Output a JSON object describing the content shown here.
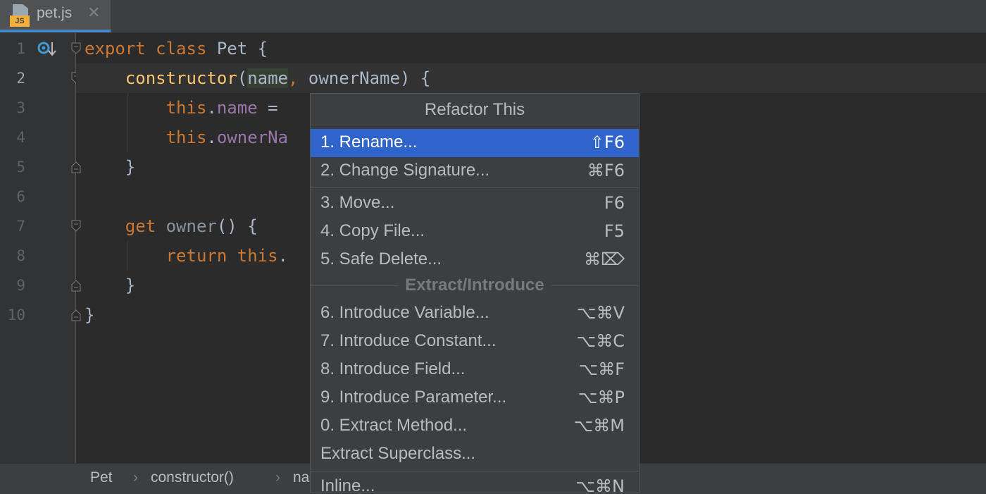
{
  "tab": {
    "file_name": "pet.js",
    "file_type_badge": "JS",
    "close_glyph": "✕"
  },
  "gutter": {
    "line_numbers": [
      "1",
      "2",
      "3",
      "4",
      "5",
      "6",
      "7",
      "8",
      "9",
      "10"
    ],
    "current_line": "2"
  },
  "code": {
    "l1": {
      "kw1": "export",
      "kw2": "class",
      "name": "Pet {"
    },
    "l2": {
      "fn": "constructor",
      "open": "(",
      "param": "name",
      "comma": ",",
      "rest": " ownerName) {"
    },
    "l3": {
      "this": "this",
      "dot": ".",
      "prop": "name",
      "rest": " ="
    },
    "l4": {
      "this": "this",
      "dot": ".",
      "prop": "ownerNa"
    },
    "l5": {
      "text": "}"
    },
    "l7": {
      "kw": "get",
      "name": "owner",
      "rest": "() {"
    },
    "l8": {
      "kw1": "return",
      "kw2": "this",
      "rest": "."
    },
    "l9": {
      "text": "}"
    },
    "l10": {
      "text": "}"
    }
  },
  "breadcrumbs": {
    "items": [
      "Pet",
      "constructor()",
      "na"
    ],
    "separator": "›"
  },
  "popup": {
    "title": "Refactor This",
    "items": [
      {
        "label": "1. Rename...",
        "shortcut": "⇧F6"
      },
      {
        "label": "2. Change Signature...",
        "shortcut": "⌘F6"
      },
      {
        "label": "3. Move...",
        "shortcut": "F6"
      },
      {
        "label": "4. Copy File...",
        "shortcut": "F5"
      },
      {
        "label": "5. Safe Delete...",
        "shortcut": "⌘⌦"
      },
      {
        "label": "6. Introduce Variable...",
        "shortcut": "⌥⌘V"
      },
      {
        "label": "7. Introduce Constant...",
        "shortcut": "⌥⌘C"
      },
      {
        "label": "8. Introduce Field...",
        "shortcut": "⌥⌘F"
      },
      {
        "label": "9. Introduce Parameter...",
        "shortcut": "⌥⌘P"
      },
      {
        "label": "0. Extract Method...",
        "shortcut": "⌥⌘M"
      },
      {
        "label": "Extract Superclass...",
        "shortcut": ""
      },
      {
        "label": "Inline...",
        "shortcut": "⌥⌘N"
      }
    ],
    "group_label": "Extract/Introduce",
    "selected_index": 0
  },
  "colors": {
    "editor_bg": "#2b2b2b",
    "keyword": "#cc7832",
    "function": "#ffc66d",
    "property": "#9876aa",
    "default_text": "#a9b7c6",
    "selection": "#2f65ca",
    "popup_bg": "#3c3f41"
  },
  "icons": [
    "js-file-icon",
    "close-icon",
    "override-method-icon",
    "fold-marker-icon"
  ]
}
